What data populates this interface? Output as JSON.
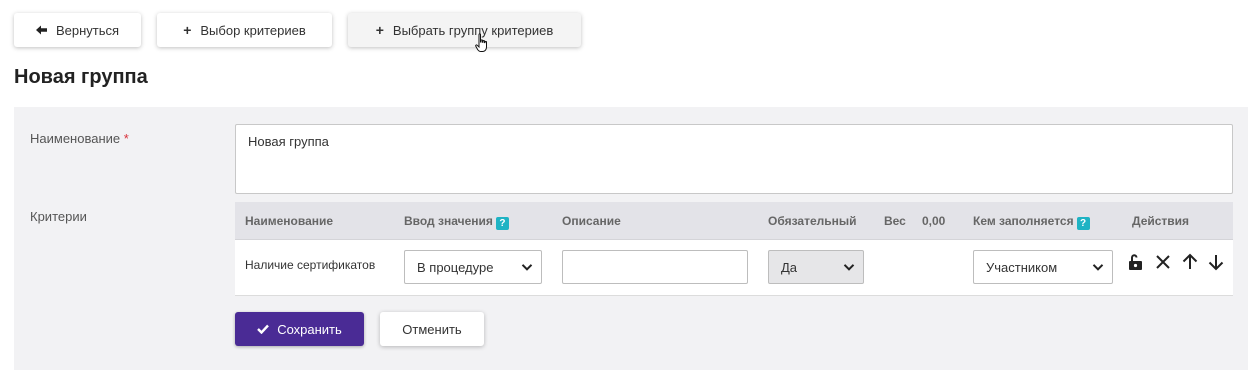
{
  "toolbar": {
    "back_label": "Вернуться",
    "select_criteria_label": "Выбор критериев",
    "select_group_label": "Выбрать группу критериев"
  },
  "page": {
    "title": "Новая группа"
  },
  "form": {
    "name_label": "Наименование",
    "required_mark": "*",
    "name_value": "Новая группа",
    "criteria_label": "Критерии"
  },
  "table": {
    "headers": {
      "name": "Наименование",
      "input": "Ввод значения",
      "description": "Описание",
      "required": "Обязательный",
      "weight": "Вес",
      "weight_total": "0,00",
      "filled_by": "Кем заполняется",
      "actions": "Действия"
    },
    "help_mark": "?",
    "rows": [
      {
        "name": "Наличие сертификатов",
        "input_mode": "В процедуре",
        "description": "",
        "required": "Да",
        "filled_by": "Участником"
      }
    ]
  },
  "footer": {
    "save_label": "Сохранить",
    "cancel_label": "Отменить"
  },
  "colors": {
    "primary": "#4a2b95",
    "help_badge": "#1fb3c4",
    "required_star": "#d9303a",
    "panel_bg": "#f2f2f4",
    "table_header_bg": "#e3e3e8"
  },
  "icons": [
    "arrow-left-icon",
    "plus-icon",
    "hand-pointer-icon",
    "chevron-down-icon",
    "unlock-icon",
    "close-icon",
    "arrow-up-icon",
    "arrow-down-icon",
    "check-icon",
    "question-icon"
  ]
}
